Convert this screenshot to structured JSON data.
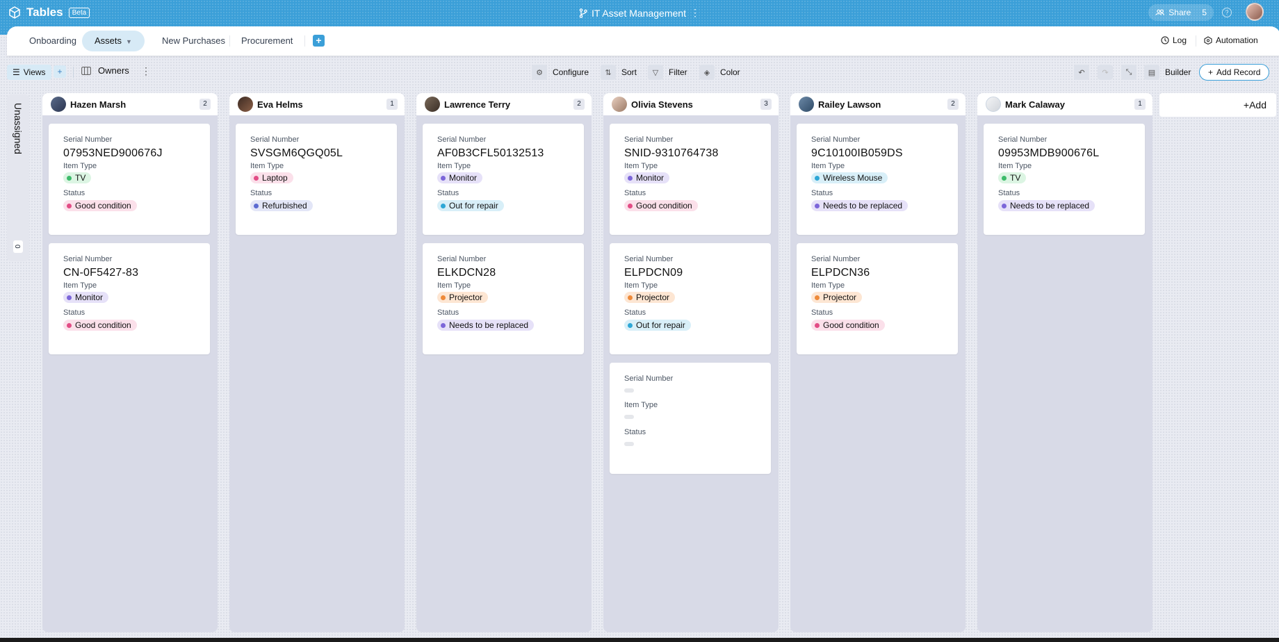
{
  "app": {
    "name": "Tables",
    "badge": "Beta",
    "doc_title": "IT Asset Management"
  },
  "share": {
    "label": "Share",
    "count": "5"
  },
  "tabs": [
    {
      "label": "Onboarding"
    },
    {
      "label": "Assets"
    },
    {
      "label": "New Purchases"
    },
    {
      "label": "Procurement"
    }
  ],
  "tab_right": {
    "log": "Log",
    "automation": "Automation"
  },
  "toolbar": {
    "views": "Views",
    "group_by": "Owners",
    "configure": "Configure",
    "sort": "Sort",
    "filter": "Filter",
    "color": "Color",
    "builder": "Builder",
    "add_record": "Add Record"
  },
  "unassigned": {
    "label": "Unassigned",
    "count": "0"
  },
  "fields": {
    "serial": "Serial Number",
    "item_type": "Item Type",
    "status": "Status"
  },
  "add_column": "+Add",
  "columns": [
    {
      "name": "Hazen Marsh",
      "count": "2",
      "cards": [
        {
          "serial": "07953NED900676J",
          "item_type": "TV",
          "status": "Good condition"
        },
        {
          "serial": "CN-0F5427-83",
          "item_type": "Monitor",
          "status": "Good condition"
        }
      ]
    },
    {
      "name": "Eva Helms",
      "count": "1",
      "cards": [
        {
          "serial": "SVSGM6QGQ05L",
          "item_type": "Laptop",
          "status": "Refurbished"
        }
      ]
    },
    {
      "name": "Lawrence Terry",
      "count": "2",
      "cards": [
        {
          "serial": "AF0B3CFL50132513",
          "item_type": "Monitor",
          "status": "Out for repair"
        },
        {
          "serial": "ELKDCN28",
          "item_type": "Projector",
          "status": "Needs to be replaced"
        }
      ]
    },
    {
      "name": "Olivia Stevens",
      "count": "3",
      "cards": [
        {
          "serial": "SNID-9310764738",
          "item_type": "Monitor",
          "status": "Good condition"
        },
        {
          "serial": "ELPDCN09",
          "item_type": "Projector",
          "status": "Out for repair"
        },
        {
          "serial": "",
          "item_type": "",
          "status": ""
        }
      ]
    },
    {
      "name": "Railey Lawson",
      "count": "2",
      "cards": [
        {
          "serial": "9C10100IB059DS",
          "item_type": "Wireless Mouse",
          "status": "Needs to be replaced"
        },
        {
          "serial": "ELPDCN36",
          "item_type": "Projector",
          "status": "Good condition"
        }
      ]
    },
    {
      "name": "Mark Calaway",
      "count": "1",
      "cards": [
        {
          "serial": "09953MDB900676L",
          "item_type": "TV",
          "status": "Needs to be replaced"
        }
      ]
    }
  ],
  "colors": {
    "accent": "#3b9fd8",
    "chip_TV": "#dcf5e3",
    "dot_TV": "#3dbb6a",
    "chip_Monitor": "#e6e1f8",
    "dot_Monitor": "#7c66d9",
    "chip_Laptop": "#fbe0ea",
    "dot_Laptop": "#e24d86",
    "chip_Projector": "#fde6d3",
    "dot_Projector": "#ee8a3a",
    "chip_Wireless Mouse": "#d8eff8",
    "dot_Wireless Mouse": "#2ea7d6",
    "chip_Good condition": "#fbe0ea",
    "dot_Good condition": "#e24d86",
    "chip_Refurbished": "#e3e6f7",
    "dot_Refurbished": "#5c6bd1",
    "chip_Out for repair": "#d8eff8",
    "dot_Out for repair": "#2ea7d6",
    "chip_Needs to be replaced": "#e6e1f8",
    "dot_Needs to be replaced": "#7c66d9"
  }
}
